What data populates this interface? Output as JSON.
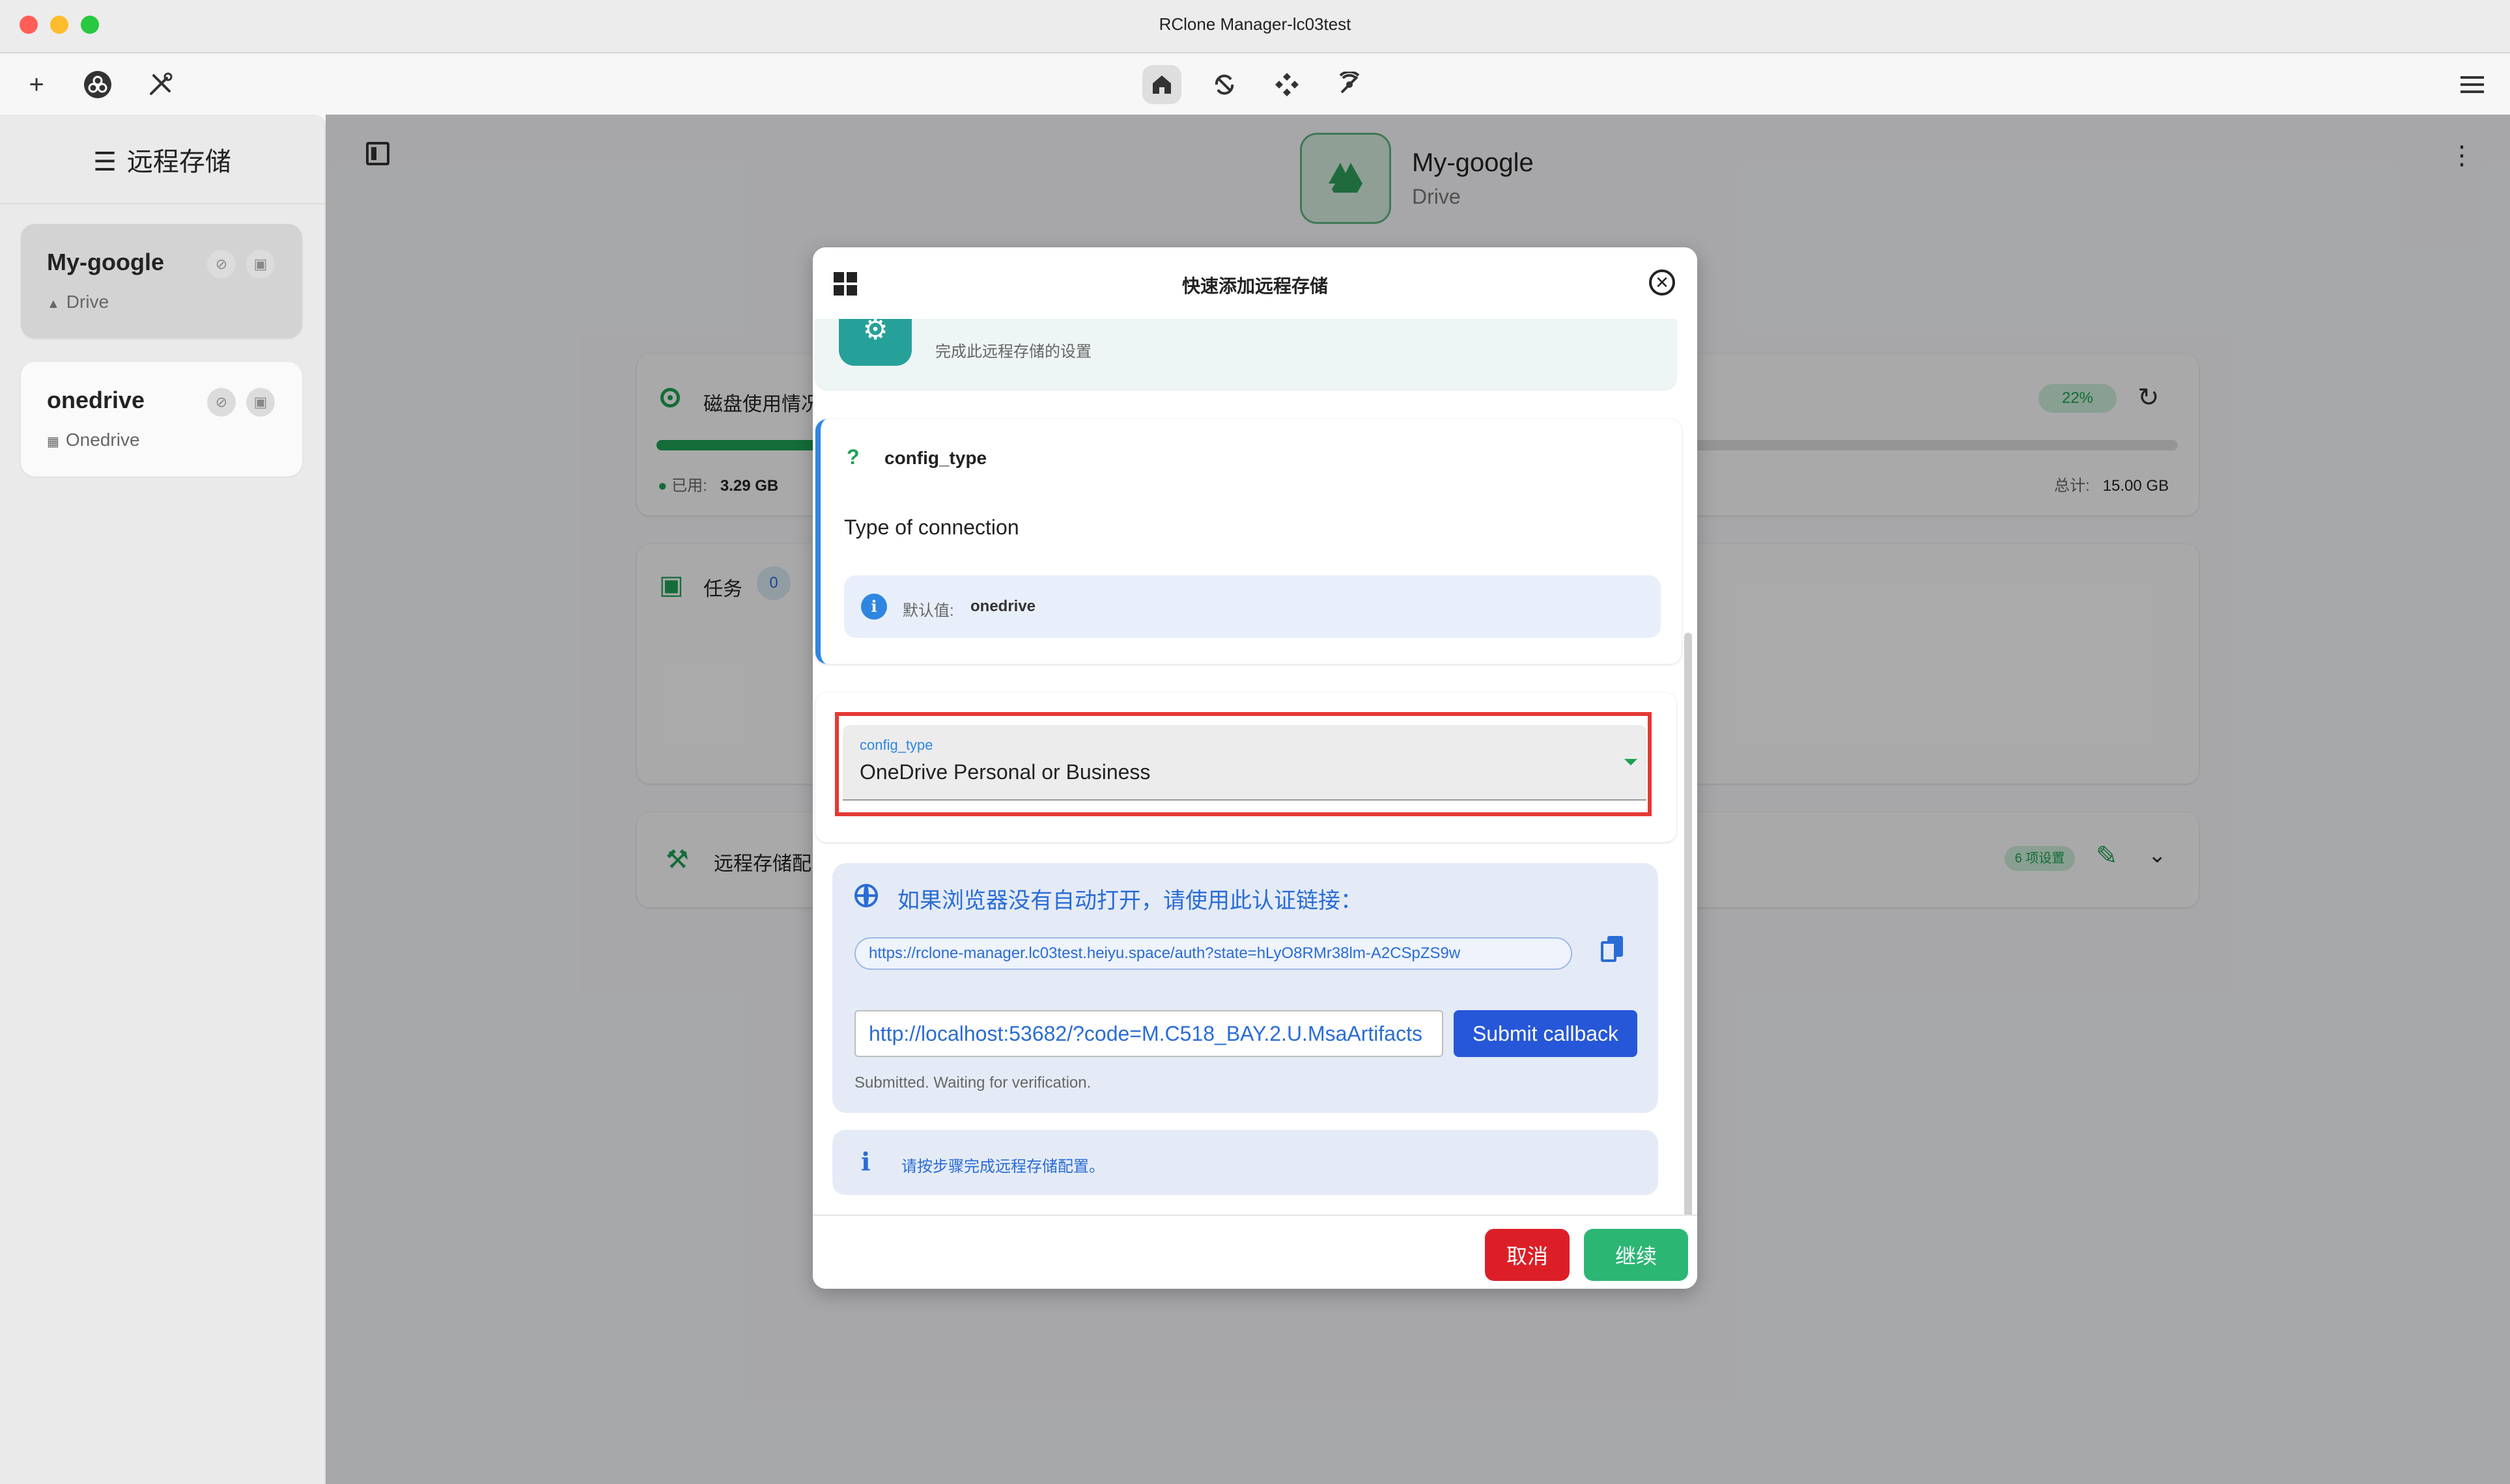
{
  "window": {
    "title": "RClone Manager-lc03test"
  },
  "toolbar": {
    "left_icons": [
      "plus-icon",
      "rclone-icon",
      "tools-icon"
    ],
    "center_icons": [
      "home-icon",
      "sync-icon",
      "mount-icon",
      "serve-icon"
    ],
    "menu_icon": "hamburger-menu-icon"
  },
  "sidebar": {
    "title": "远程存储",
    "remotes": [
      {
        "name": "My-google",
        "type": "Drive",
        "selected": true
      },
      {
        "name": "onedrive",
        "type": "Onedrive",
        "selected": false
      }
    ]
  },
  "main": {
    "remote_name": "My-google",
    "remote_type": "Drive",
    "disk": {
      "label": "磁盘使用情况",
      "percent_label": "22%",
      "used_label": "已用:",
      "used_value": "3.29 GB",
      "total_label": "总计:",
      "total_value": "15.00 GB",
      "fill_fraction": 0.22
    },
    "tasks": {
      "label": "任务",
      "count": "0"
    },
    "config": {
      "label": "远程存储配",
      "badge": "6 项设置"
    }
  },
  "dialog": {
    "title": "快速添加远程存储",
    "step_desc": "完成此远程存储的设置",
    "question": {
      "key": "config_type",
      "help": "Type of connection",
      "default_label": "默认值:",
      "default_value": "onedrive"
    },
    "select": {
      "label": "config_type",
      "value": "OneDrive Personal or Business"
    },
    "auth": {
      "title": "如果浏览器没有自动打开，请使用此认证链接：",
      "link": "https://rclone-manager.lc03test.heiyu.space/auth?state=hLyO8RMr38lm-A2CSpZS9w",
      "callback_value": "http://localhost:53682/?code=M.C518_BAY.2.U.MsaArtifacts",
      "submit_label": "Submit callback",
      "status": "Submitted. Waiting for verification."
    },
    "hint": "请按步骤完成远程存储配置。",
    "cancel_label": "取消",
    "next_label": "继续"
  },
  "colors": {
    "accent_green": "#2bb673",
    "danger_red": "#dc1f27",
    "link_blue": "#2a6cd6",
    "highlight_red": "#e53935"
  }
}
